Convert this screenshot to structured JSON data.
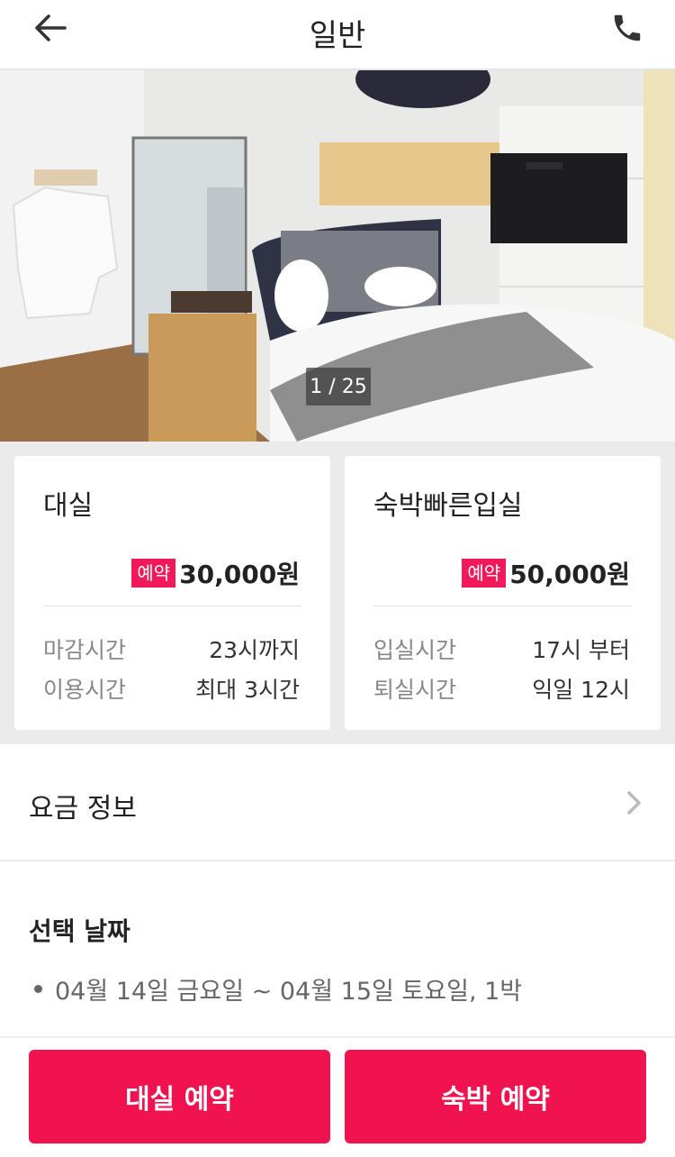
{
  "header": {
    "title": "일반",
    "back_icon": "arrow-left-icon",
    "call_icon": "phone-icon"
  },
  "photo": {
    "counter": "1 / 25",
    "current": 1,
    "total": 25
  },
  "rooms": [
    {
      "name": "대실",
      "badge": "예약",
      "price": "30,000원",
      "rows": [
        {
          "label": "마감시간",
          "value": "23시까지"
        },
        {
          "label": "이용시간",
          "value": "최대 3시간"
        }
      ]
    },
    {
      "name": "숙박빠른입실",
      "badge": "예약",
      "price": "50,000원",
      "rows": [
        {
          "label": "입실시간",
          "value": "17시 부터"
        },
        {
          "label": "퇴실시간",
          "value": "익일 12시"
        }
      ]
    }
  ],
  "fee_info": {
    "label": "요금 정보",
    "icon": "chevron-right-icon"
  },
  "selected_date": {
    "heading": "선택 날짜",
    "item": "04월 14일 금요일 ~ 04월 15일 토요일, 1박"
  },
  "actions": {
    "day_use": "대실 예약",
    "overnight": "숙박 예약"
  },
  "colors": {
    "accent": "#f0134f",
    "badge": "#f1195a",
    "section_bg": "#ebebeb"
  }
}
